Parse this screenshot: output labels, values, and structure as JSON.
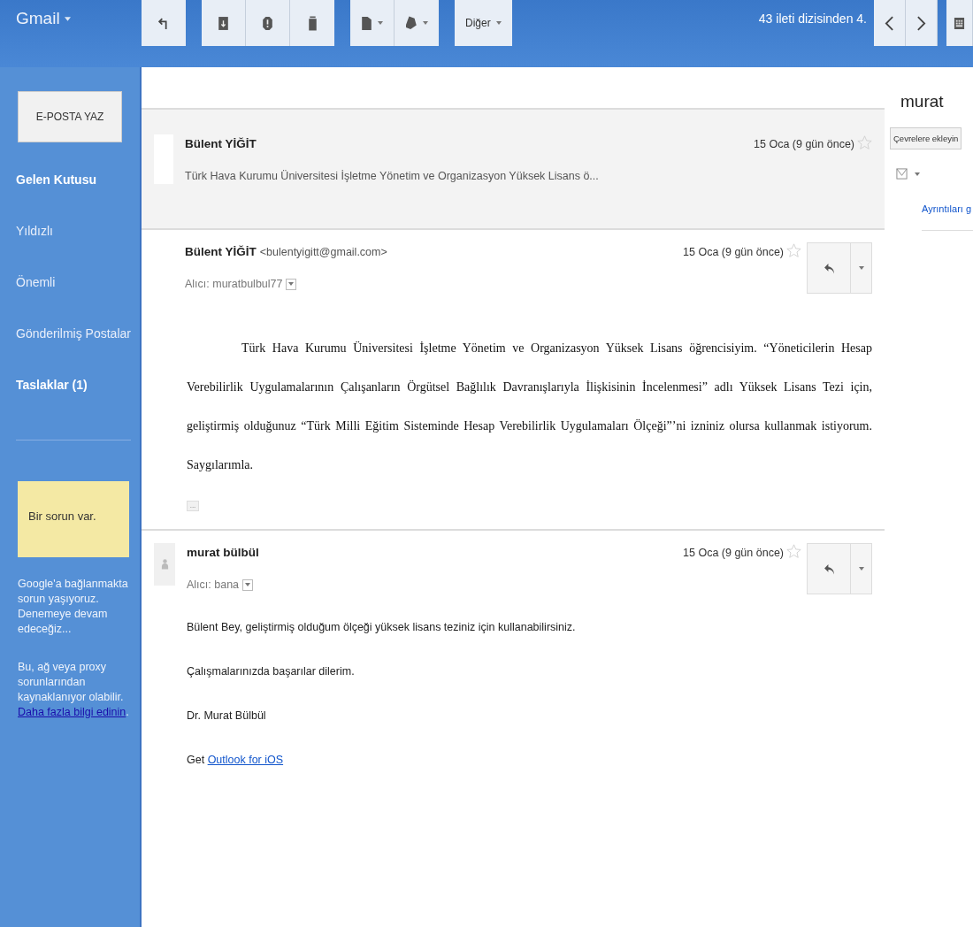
{
  "header": {
    "logo": "Gmail",
    "more_button": "Diğer",
    "pager": "43 ileti dizisinden 4."
  },
  "sidebar": {
    "compose": "E-POSTA YAZ",
    "items": [
      {
        "label": "Gelen Kutusu",
        "bold": true
      },
      {
        "label": "Yıldızlı",
        "bold": false
      },
      {
        "label": "Önemli",
        "bold": false
      },
      {
        "label": "Gönderilmiş Postalar",
        "bold": false
      },
      {
        "label": "Taslaklar (1)",
        "bold": true
      }
    ],
    "notice": {
      "title": "Bir sorun var.",
      "paragraphs": [
        {
          "text": "Google'a bağlanmakta sorun yaşıyoruz. Denemeye devam edeceğiz..."
        },
        {
          "text": "Bu, ağ veya proxy sorunlarından kaynaklanıyor olabilir. ",
          "link": "Daha fazla bilgi edinin",
          "after": "."
        }
      ]
    }
  },
  "messages": [
    {
      "collapsed": true,
      "sender": "Bülent YİĞİT",
      "snippet": "Türk Hava Kurumu Üniversitesi İşletme Yönetim ve Organizasyon Yüksek Lisans ö...",
      "date": "15 Oca (9 gün önce)",
      "starred": false,
      "avatar": false
    },
    {
      "collapsed": false,
      "sender": "Bülent YİĞİT",
      "email": "<bulentyigitt@gmail.com>",
      "recipient": "Alıcı: muratbulbul77",
      "date": "15 Oca (9 gün önce)",
      "starred": false,
      "avatar": false,
      "trimmed_button": "...",
      "paragraphs": [
        {
          "kind": "formatted",
          "text": "Türk Hava Kurumu Üniversitesi İşletme Yönetim ve Organizasyon Yüksek Lisans öğrencisiyim. “Yöneticilerin Hesap Verebilirlik Uygulamalarının Çalışanların Örgütsel Bağlılık Davranışlarıyla İlişkisinin İncelenmesi” adlı Yüksek Lisans Tezi için, geliştirmiş olduğunuz “Türk Milli Eğitim Sisteminde Hesap Verebilirlik Uygulamaları Ölçeği”’ni izniniz olursa kullanmak istiyorum. Saygılarımla."
        }
      ]
    },
    {
      "collapsed": false,
      "sender": "murat bülbül",
      "recipient": "Alıcı: bana",
      "date": "15 Oca (9 gün önce)",
      "starred": false,
      "avatar": true,
      "paragraphs": [
        {
          "kind": "plain",
          "text": "Bülent Bey, geliştirmiş olduğum ölçeği yüksek lisans teziniz için kullanabilirsiniz."
        },
        {
          "kind": "plain",
          "text": "Çalışmalarınızda başarılar dilerim."
        },
        {
          "kind": "plain",
          "text": "Dr. Murat Bülbül"
        },
        {
          "kind": "plain",
          "text": "Get ",
          "link": "Outlook for iOS"
        }
      ]
    }
  ],
  "contact": {
    "name": "murat",
    "button": "Çevrelere ekleyin",
    "details_link": "Ayrıntıları g"
  }
}
